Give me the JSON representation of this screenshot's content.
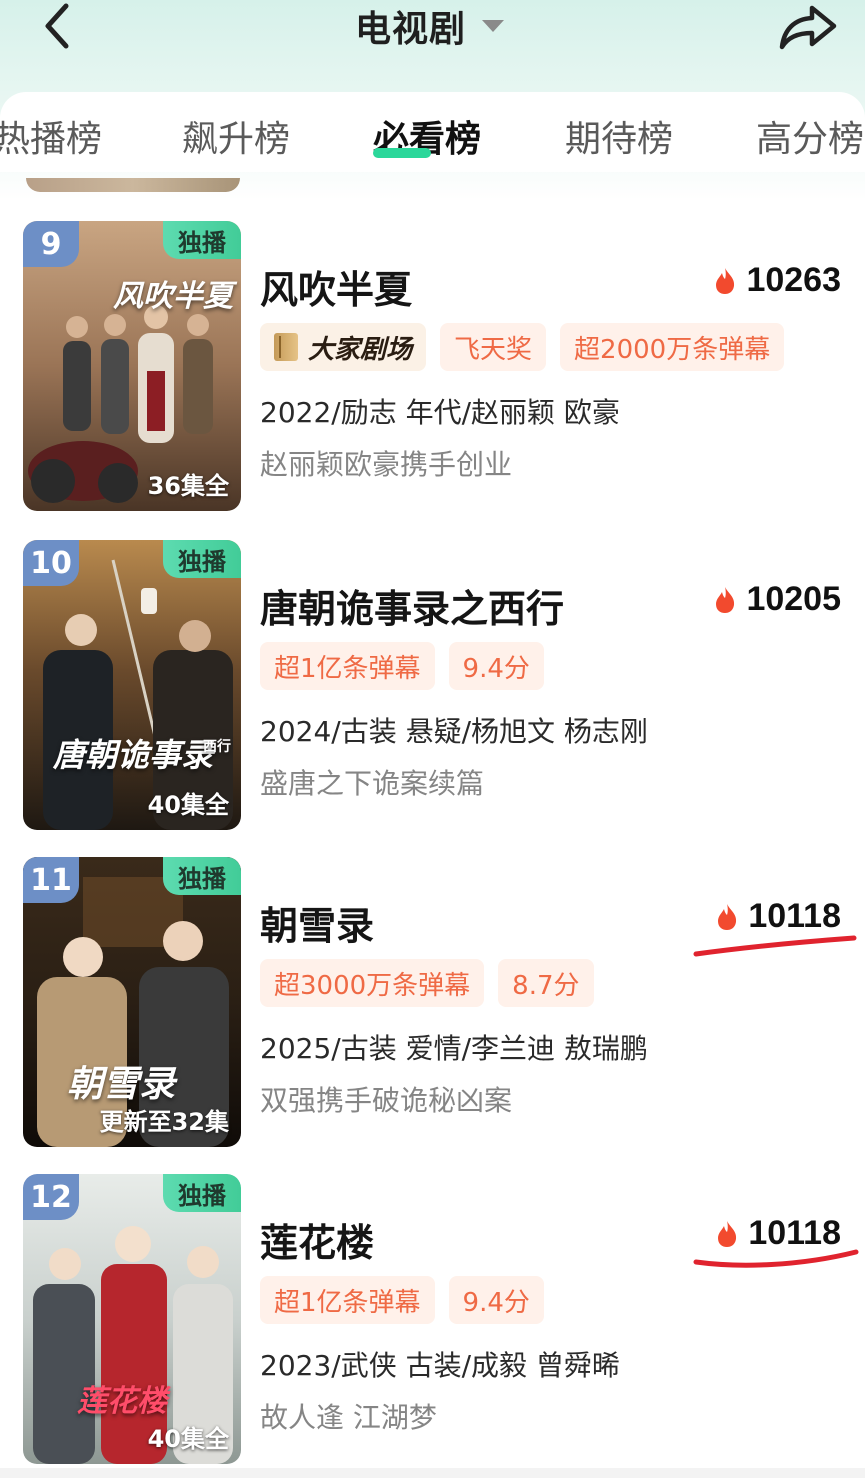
{
  "header": {
    "title": "电视剧",
    "back_icon": "chevron-left-icon",
    "share_icon": "share-arrow-icon",
    "dropdown_icon": "caret-down-icon"
  },
  "tabs": [
    {
      "label": "热播榜",
      "active": false
    },
    {
      "label": "飙升榜",
      "active": false
    },
    {
      "label": "必看榜",
      "active": true
    },
    {
      "label": "期待榜",
      "active": false
    },
    {
      "label": "高分榜",
      "active": false
    }
  ],
  "colors": {
    "accent_green": "#2bd79a",
    "tag_orange": "#ef6a45",
    "tag_bg": "#fff1ea",
    "rank_blue": "#6d8fc6",
    "annotation_red": "#e0232e"
  },
  "items": [
    {
      "rank": "9",
      "badge": "独播",
      "episodes": "36集全",
      "poster_title": "风吹半夏",
      "title": "风吹半夏",
      "heat": "10263",
      "brand_tag": "大家剧场",
      "tags": [
        "飞天奖",
        "超2000万条弹幕"
      ],
      "meta": "2022/励志 年代/赵丽颖 欧豪",
      "desc": "赵丽颖欧豪携手创业"
    },
    {
      "rank": "10",
      "badge": "独播",
      "episodes": "40集全",
      "poster_title": "唐朝诡事录",
      "poster_subtitle": "西行",
      "title": "唐朝诡事录之西行",
      "heat": "10205",
      "tags": [
        "超1亿条弹幕",
        "9.4分"
      ],
      "meta": "2024/古装 悬疑/杨旭文 杨志刚",
      "desc": "盛唐之下诡案续篇"
    },
    {
      "rank": "11",
      "badge": "独播",
      "episodes": "更新至32集",
      "poster_title": "朝雪录",
      "title": "朝雪录",
      "heat": "10118",
      "tags": [
        "超3000万条弹幕",
        "8.7分"
      ],
      "meta": "2025/古装 爱情/李兰迪 敖瑞鹏",
      "desc": "双强携手破诡秘凶案"
    },
    {
      "rank": "12",
      "badge": "独播",
      "episodes": "40集全",
      "poster_title": "莲花楼",
      "title": "莲花楼",
      "heat": "10118",
      "tags": [
        "超1亿条弹幕",
        "9.4分"
      ],
      "meta": "2023/武侠 古装/成毅 曾舜晞",
      "desc": "故人逢 江湖梦"
    }
  ]
}
